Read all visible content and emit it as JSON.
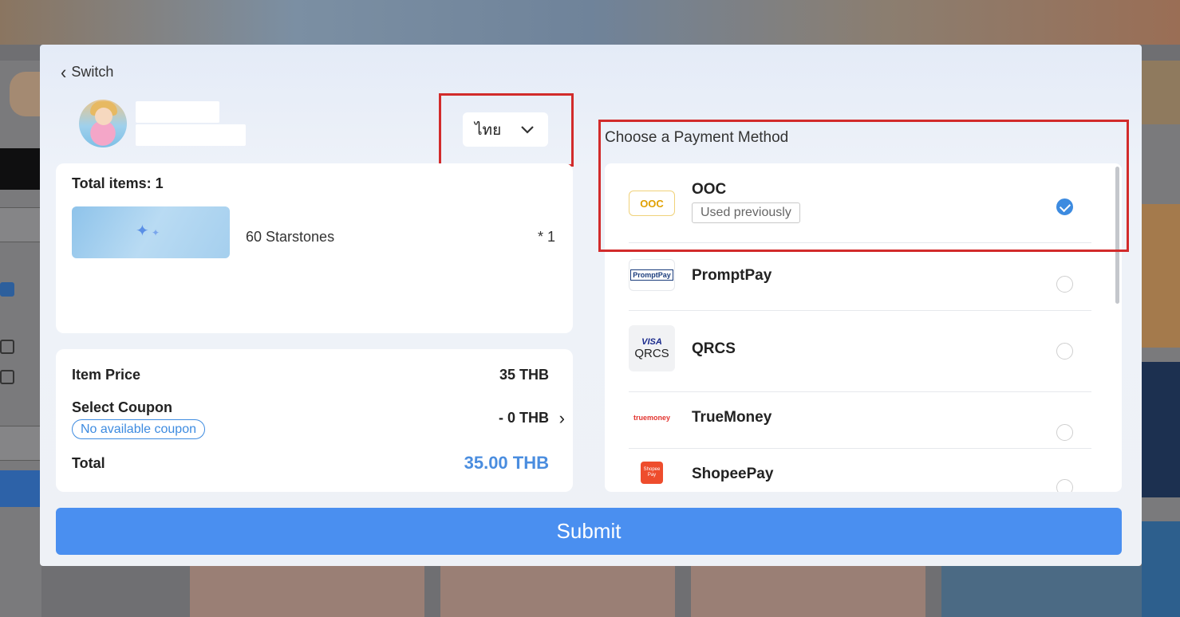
{
  "header": {
    "back_label": "Switch",
    "back_icon": "chevron-left-icon"
  },
  "language": {
    "selected": "ไทย",
    "icon": "chevron-down-icon"
  },
  "order": {
    "total_items_label": "Total items: 1",
    "items": [
      {
        "name": "60 Starstones",
        "quantity": "* 1"
      }
    ]
  },
  "pricing": {
    "item_price_label": "Item Price",
    "item_price_value": "35 THB",
    "coupon_label": "Select Coupon",
    "coupon_badge": "No available coupon",
    "coupon_value": "- 0 THB",
    "total_label": "Total",
    "total_value": "35.00 THB",
    "total_color": "#4a8ddf"
  },
  "payment": {
    "title": "Choose a Payment Method",
    "methods": [
      {
        "name": "OOC",
        "badge": "Used previously",
        "selected": true,
        "logo_text": "OOC"
      },
      {
        "name": "PromptPay",
        "selected": false,
        "logo_text": "PromptPay"
      },
      {
        "name": "QRCS",
        "selected": false,
        "logo_text_top": "VISA",
        "logo_text": "QRCS"
      },
      {
        "name": "TrueMoney",
        "selected": false,
        "logo_text": "truemoney"
      },
      {
        "name": "ShopeePay",
        "selected": false,
        "logo_text": "Shopee Pay"
      }
    ]
  },
  "actions": {
    "submit_label": "Submit"
  },
  "colors": {
    "accent": "#4a8ff0",
    "highlight_box": "#d22b2b",
    "selected_radio": "#3d8be0"
  }
}
